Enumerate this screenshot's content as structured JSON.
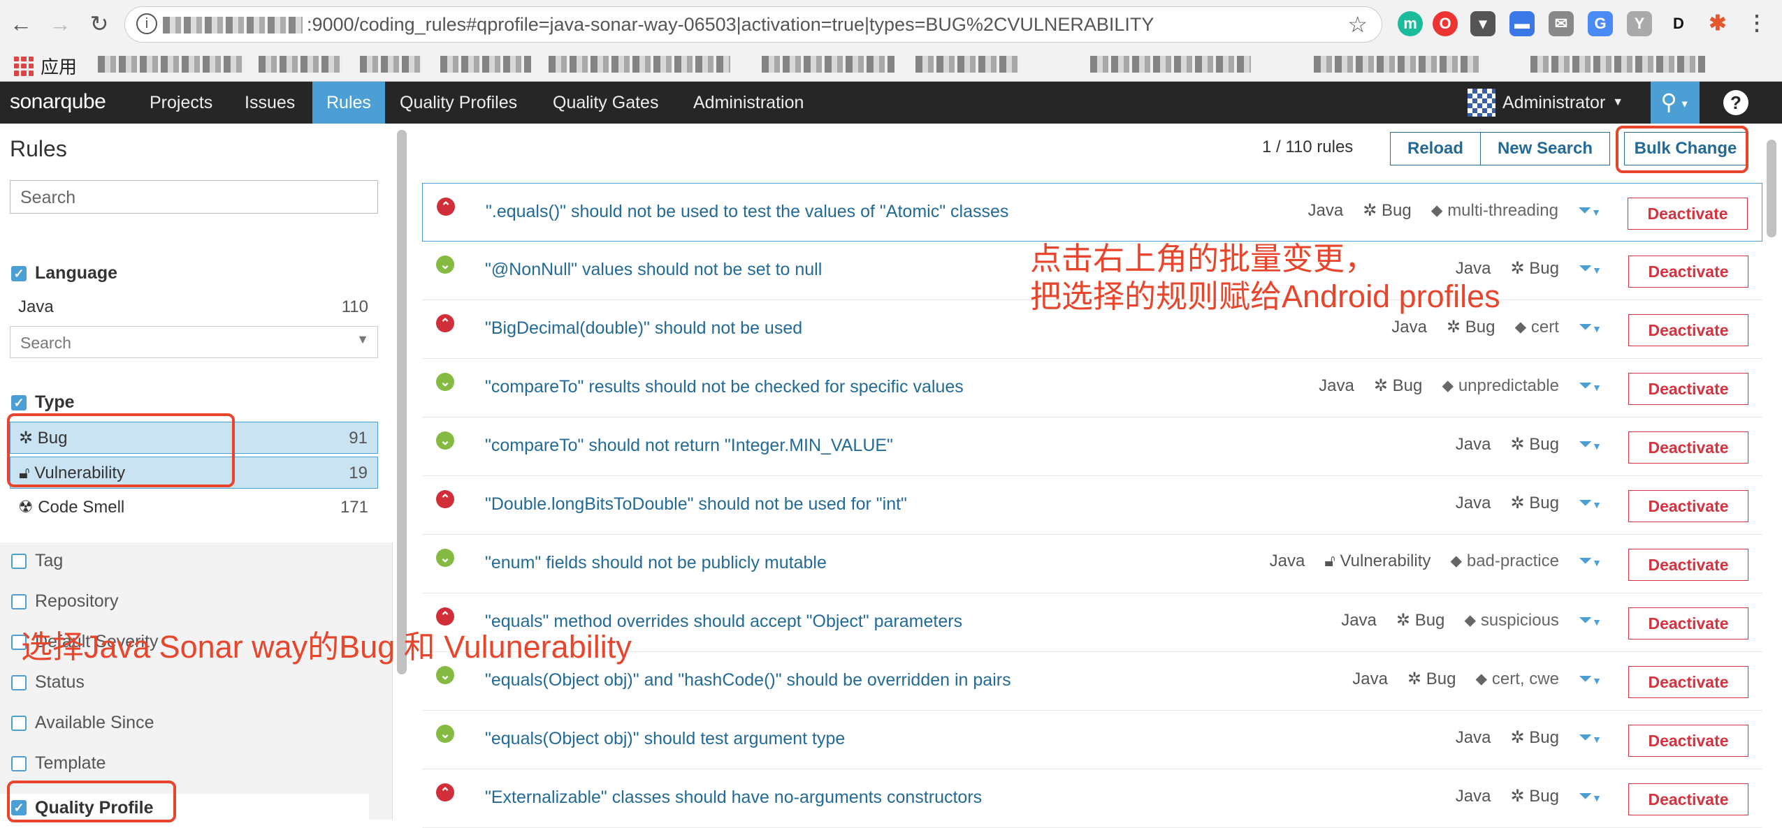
{
  "browser": {
    "url": ":9000/coding_rules#qprofile=java-sonar-way-06503|activation=true|types=BUG%2CVULNERABILITY",
    "bookmark_apps": "应用"
  },
  "topnav": {
    "logo": "sonarqube",
    "items": [
      "Projects",
      "Issues",
      "Rules",
      "Quality Profiles",
      "Quality Gates",
      "Administration"
    ],
    "active": "Rules",
    "user": "Administrator",
    "help": "?"
  },
  "sidebar": {
    "title": "Rules",
    "search_placeholder": "Search",
    "language": {
      "label": "Language",
      "items": [
        {
          "name": "Java",
          "count": "110"
        }
      ],
      "search_placeholder": "Search"
    },
    "type": {
      "label": "Type",
      "items": [
        {
          "name": "Bug",
          "count": "91"
        },
        {
          "name": "Vulnerability",
          "count": "19"
        },
        {
          "name": "Code Smell",
          "count": "171"
        }
      ]
    },
    "closed_facets": [
      "Tag",
      "Repository",
      "Default Severity",
      "Status",
      "Available Since",
      "Template"
    ],
    "quality_profile": "Quality Profile"
  },
  "toolbar": {
    "count": "1 / 110 rules",
    "reload": "Reload",
    "new_search": "New Search",
    "bulk_change": "Bulk Change"
  },
  "deactivate_label": "Deactivate",
  "rules": [
    {
      "name": "\".equals()\" should not be used to test the values of \"Atomic\" classes",
      "lang": "Java",
      "type": "Bug",
      "tag": "multi-threading",
      "sev": "blocker"
    },
    {
      "name": "\"@NonNull\" values should not be set to null",
      "lang": "Java",
      "type": "Bug",
      "tag": "",
      "sev": "minor"
    },
    {
      "name": "\"BigDecimal(double)\" should not be used",
      "lang": "Java",
      "type": "Bug",
      "tag": "cert",
      "sev": "blocker"
    },
    {
      "name": "\"compareTo\" results should not be checked for specific values",
      "lang": "Java",
      "type": "Bug",
      "tag": "unpredictable",
      "sev": "minor"
    },
    {
      "name": "\"compareTo\" should not return \"Integer.MIN_VALUE\"",
      "lang": "Java",
      "type": "Bug",
      "tag": "",
      "sev": "minor"
    },
    {
      "name": "\"Double.longBitsToDouble\" should not be used for \"int\"",
      "lang": "Java",
      "type": "Bug",
      "tag": "",
      "sev": "blocker"
    },
    {
      "name": "\"enum\" fields should not be publicly mutable",
      "lang": "Java",
      "type": "Vulnerability",
      "tag": "bad-practice",
      "sev": "minor"
    },
    {
      "name": "\"equals\" method overrides should accept \"Object\" parameters",
      "lang": "Java",
      "type": "Bug",
      "tag": "suspicious",
      "sev": "blocker"
    },
    {
      "name": "\"equals(Object obj)\" and \"hashCode()\" should be overridden in pairs",
      "lang": "Java",
      "type": "Bug",
      "tag": "cert, cwe",
      "sev": "minor"
    },
    {
      "name": "\"equals(Object obj)\" should test argument type",
      "lang": "Java",
      "type": "Bug",
      "tag": "",
      "sev": "minor"
    },
    {
      "name": "\"Externalizable\" classes should have no-arguments constructors",
      "lang": "Java",
      "type": "Bug",
      "tag": "",
      "sev": "blocker"
    }
  ],
  "annotations": {
    "note_right_line1": "点击右上角的批量变更，",
    "note_right_line2": "把选择的规则赋给Android profiles",
    "note_left": "选择Java Sonar way的Bug 和 Vulunerability"
  }
}
